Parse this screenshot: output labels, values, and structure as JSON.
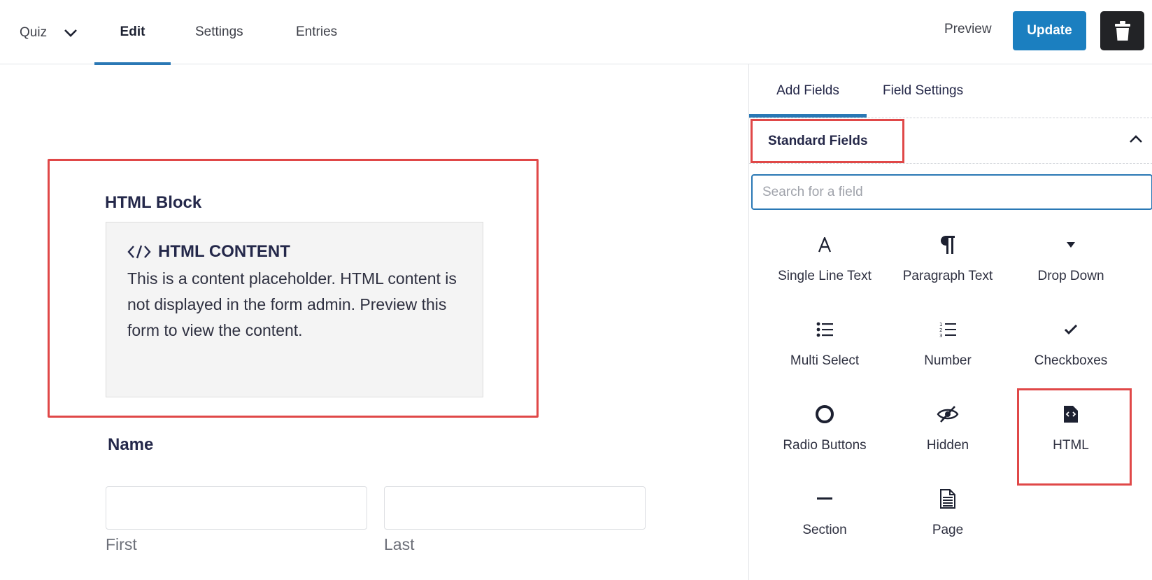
{
  "header": {
    "form_switch_label": "Quiz",
    "tabs": [
      {
        "label": "Edit",
        "active": true
      },
      {
        "label": "Settings",
        "active": false
      },
      {
        "label": "Entries",
        "active": false
      }
    ],
    "preview_label": "Preview",
    "update_label": "Update",
    "accent_color": "#1b7fc0"
  },
  "canvas": {
    "html_block": {
      "title": "HTML Block",
      "placeholder_heading": "HTML CONTENT",
      "placeholder_text": "This is a content placeholder. HTML content is not displayed in the form admin. Preview this form to view the content."
    },
    "name_field": {
      "label": "Name",
      "first_label": "First",
      "last_label": "Last"
    }
  },
  "sidebar": {
    "tabs": [
      {
        "label": "Add Fields",
        "active": true
      },
      {
        "label": "Field Settings",
        "active": false
      }
    ],
    "section_title": "Standard Fields",
    "search_placeholder": "Search for a field",
    "fields": [
      {
        "label": "Single Line Text",
        "icon": "text-icon"
      },
      {
        "label": "Paragraph Text",
        "icon": "paragraph-icon"
      },
      {
        "label": "Drop Down",
        "icon": "dropdown-caret-icon"
      },
      {
        "label": "Multi Select",
        "icon": "list-icon"
      },
      {
        "label": "Number",
        "icon": "numbered-list-icon"
      },
      {
        "label": "Checkboxes",
        "icon": "checkmark-icon"
      },
      {
        "label": "Radio Buttons",
        "icon": "radio-circle-icon"
      },
      {
        "label": "Hidden",
        "icon": "eye-slash-icon"
      },
      {
        "label": "HTML",
        "icon": "code-file-icon"
      },
      {
        "label": "Section",
        "icon": "dash-icon"
      },
      {
        "label": "Page",
        "icon": "page-icon"
      }
    ],
    "highlight_color": "#e04848"
  }
}
